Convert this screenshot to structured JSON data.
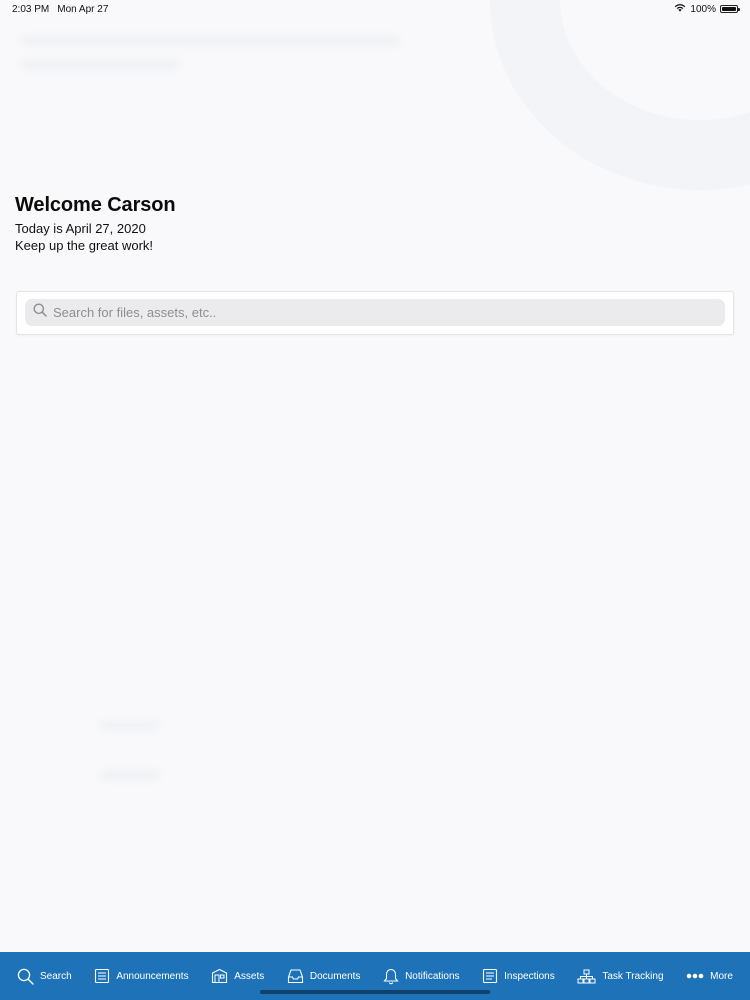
{
  "status_bar": {
    "time": "2:03 PM",
    "date": "Mon Apr 27",
    "battery_percent": "100%",
    "battery_level": 1.0,
    "wifi_icon": "wifi-icon",
    "battery_icon": "battery-icon"
  },
  "welcome": {
    "title": "Welcome Carson",
    "date_line": "Today is April 27, 2020",
    "message": "Keep up the great work!"
  },
  "search": {
    "placeholder": "Search for files, assets, etc.."
  },
  "tab_bar": {
    "background": "#1e73b8",
    "tabs": [
      {
        "label": "Search",
        "icon": "search-icon"
      },
      {
        "label": "Announcements",
        "icon": "announcements-icon"
      },
      {
        "label": "Assets",
        "icon": "assets-icon"
      },
      {
        "label": "Documents",
        "icon": "documents-icon"
      },
      {
        "label": "Notifications",
        "icon": "bell-icon"
      },
      {
        "label": "Inspections",
        "icon": "inspections-icon"
      },
      {
        "label": "Task Tracking",
        "icon": "task-tracking-icon"
      },
      {
        "label": "More",
        "icon": "more-icon"
      }
    ]
  }
}
